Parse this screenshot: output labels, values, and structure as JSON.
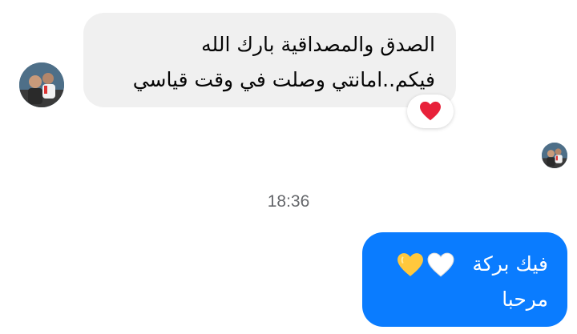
{
  "incoming": {
    "line1": "الصدق والمصداقية بارك الله",
    "line2": "فيكم..امانتي وصلت في وقت قياسي",
    "reaction": "red-heart"
  },
  "timestamp": "18:36",
  "outgoing": {
    "line1": "فيك بركة",
    "line2": "مرحبا",
    "emojis": [
      "white-heart",
      "yellow-heart"
    ]
  },
  "colors": {
    "outgoing_bubble": "#0a7cff",
    "incoming_bubble": "#f0f0f0",
    "timestamp": "#65676b",
    "red_heart": "#e8213a",
    "yellow_heart": "#ffc83d"
  }
}
